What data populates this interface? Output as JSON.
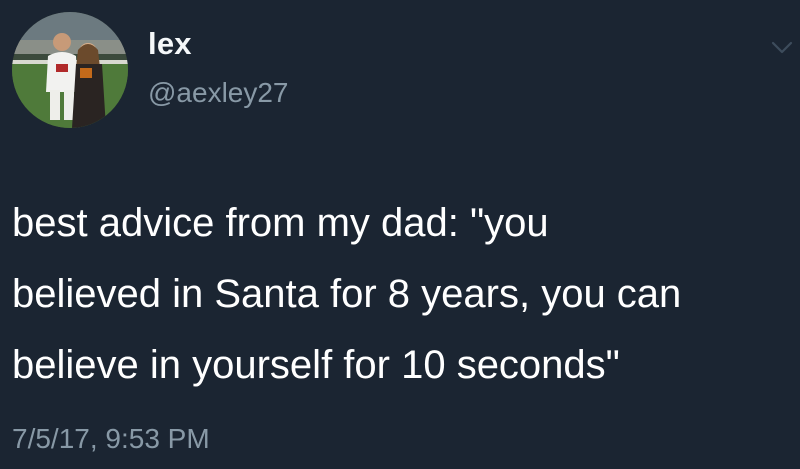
{
  "tweet": {
    "display_name": "lex",
    "handle": "@aexley27",
    "text": "best advice from my dad: \"you\nbelieved in Santa for 8 years, you can\nbelieve in yourself for 10 seconds\"",
    "timestamp": "7/5/17, 9:53 PM"
  },
  "colors": {
    "background": "#1b2532",
    "primary_text": "#ffffff",
    "secondary_text": "#8899a6"
  },
  "icons": {
    "avatar": "profile-photo",
    "menu": "chevron-down-icon"
  }
}
